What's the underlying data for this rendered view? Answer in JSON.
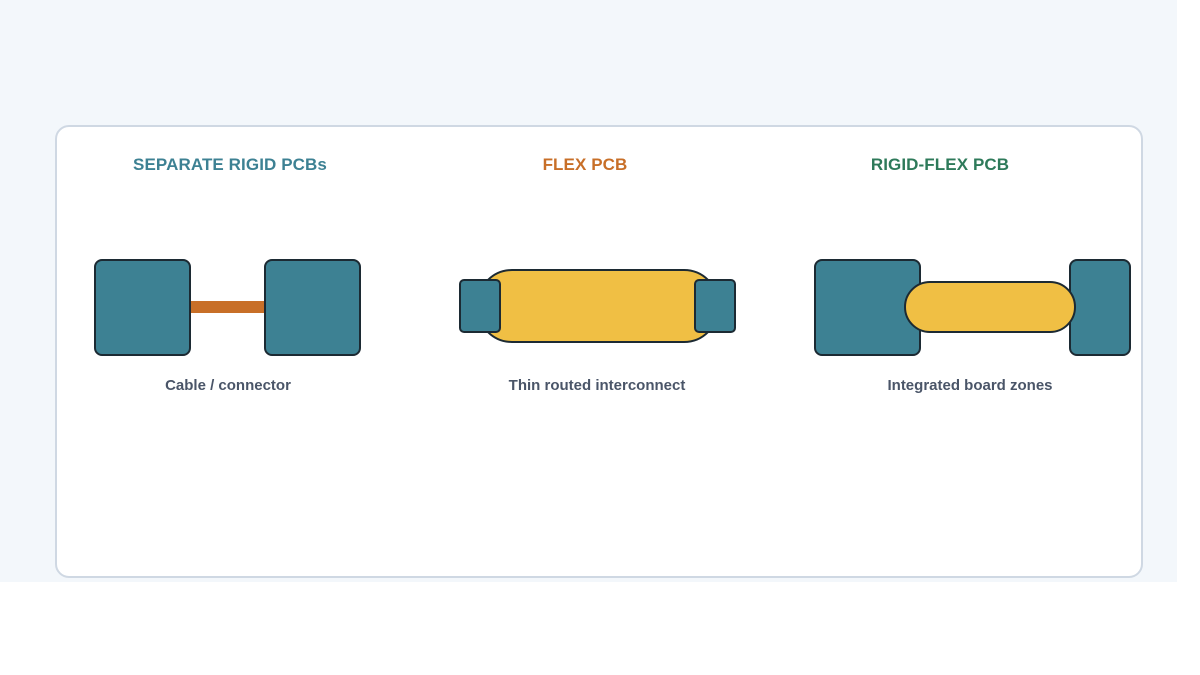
{
  "colors": {
    "background": "#f3f7fb",
    "card_border": "#cfd8e3",
    "rigid_board": "#3d8193",
    "flex_board": "#f0bf44",
    "cable": "#c86f28",
    "outline": "#1c2a33",
    "caption_text": "#4a5568"
  },
  "panels": [
    {
      "title": "SEPARATE RIGID PCBs",
      "title_color": "#3d8193",
      "caption": "Cable / connector"
    },
    {
      "title": "FLEX PCB",
      "title_color": "#c86f28",
      "caption": "Thin routed interconnect"
    },
    {
      "title": "RIGID-FLEX PCB",
      "title_color": "#2e7a5a",
      "caption": "Integrated board zones"
    }
  ]
}
